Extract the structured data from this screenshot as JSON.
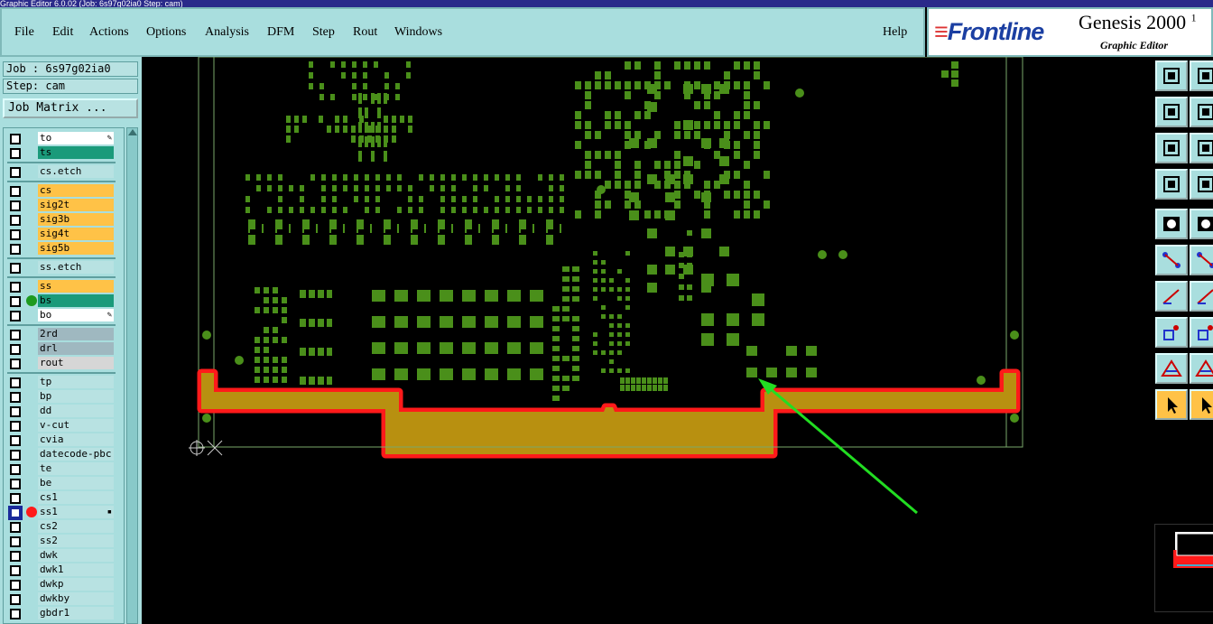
{
  "window": {
    "title": "Graphic Editor 6.0.02 (Job: 6s97g02ia0 Step: cam)"
  },
  "menu": {
    "items": [
      "File",
      "Edit",
      "Actions",
      "Options",
      "Analysis",
      "DFM",
      "Step",
      "Rout",
      "Windows"
    ],
    "help": "Help"
  },
  "logo": {
    "brand": "Frontline",
    "product": "Genesis 2000",
    "product_suffix": "1",
    "subtitle": "Graphic Editor"
  },
  "job": {
    "job_label": "Job : 6s97g02ia0",
    "step_label": "Step: cam",
    "matrix_button": "Job Matrix ..."
  },
  "layers": [
    {
      "name": "to",
      "color": "#ffffff",
      "mark": "edit",
      "group": 0
    },
    {
      "name": "ts",
      "color": "#1a9a7a",
      "group": 0
    },
    {
      "name": "cs.etch",
      "color": "#b8e2e2",
      "group": 1
    },
    {
      "name": "cs",
      "color": "#ffc247",
      "group": 2
    },
    {
      "name": "sig2t",
      "color": "#ffc247",
      "group": 2
    },
    {
      "name": "sig3b",
      "color": "#ffc247",
      "group": 2
    },
    {
      "name": "sig4t",
      "color": "#ffc247",
      "group": 2
    },
    {
      "name": "sig5b",
      "color": "#ffc247",
      "group": 2
    },
    {
      "name": "ss.etch",
      "color": "#b8e2e2",
      "group": 3
    },
    {
      "name": "ss",
      "color": "#ffc247",
      "group": 4
    },
    {
      "name": "bs",
      "color": "#1a9a7a",
      "dot": "#1e9a1e",
      "group": 4
    },
    {
      "name": "bo",
      "color": "#ffffff",
      "mark": "edit",
      "group": 4
    },
    {
      "name": "2rd",
      "color": "#9fb8c0",
      "group": 5
    },
    {
      "name": "drl",
      "color": "#9fb8c0",
      "group": 5
    },
    {
      "name": "rout",
      "color": "#d6d6d6",
      "group": 5
    },
    {
      "name": "tp",
      "color": "#b8e2e2",
      "group": 6
    },
    {
      "name": "bp",
      "color": "#b8e2e2",
      "group": 6
    },
    {
      "name": "dd",
      "color": "#b8e2e2",
      "group": 6
    },
    {
      "name": "v-cut",
      "color": "#b8e2e2",
      "group": 6
    },
    {
      "name": "cvia",
      "color": "#b8e2e2",
      "group": 6
    },
    {
      "name": "datecode-pbc",
      "color": "#b8e2e2",
      "group": 6
    },
    {
      "name": "te",
      "color": "#b8e2e2",
      "group": 6
    },
    {
      "name": "be",
      "color": "#b8e2e2",
      "group": 6
    },
    {
      "name": "cs1",
      "color": "#b8e2e2",
      "group": 6
    },
    {
      "name": "ss1",
      "color": "#b8e2e2",
      "dot": "#ff1a1a",
      "mark": "work",
      "active": true,
      "group": 6
    },
    {
      "name": "cs2",
      "color": "#b8e2e2",
      "group": 6
    },
    {
      "name": "ss2",
      "color": "#b8e2e2",
      "group": 6
    },
    {
      "name": "dwk",
      "color": "#b8e2e2",
      "group": 6
    },
    {
      "name": "dwk1",
      "color": "#b8e2e2",
      "group": 6
    },
    {
      "name": "dwkp",
      "color": "#b8e2e2",
      "group": 6
    },
    {
      "name": "dwkby",
      "color": "#b8e2e2",
      "group": 6
    },
    {
      "name": "gbdr1",
      "color": "#b8e2e2",
      "group": 6
    }
  ],
  "canvas": {
    "background": "#000000",
    "pad_color": "#4a8f1a",
    "outline_color": "#7aa86a",
    "trace_fill": "#b89010",
    "trace_edge": "#ff1a1a",
    "arrow_color": "#22dd22"
  },
  "toolbox": {
    "tools": [
      "layer-up-icon",
      "layer-down-icon",
      "zoom-in-icon",
      "zoom-out-icon",
      "fit-icon",
      "pan-icon",
      "measure-icon",
      "grid-icon",
      "snap-icon",
      "line-icon",
      "node-icon",
      "cross-icon",
      "arc-icon",
      "arc2-icon",
      "pad-icon",
      "line-split-icon",
      "polygon-icon",
      "polygon2-icon",
      "select-icon",
      "select-box-icon"
    ]
  }
}
